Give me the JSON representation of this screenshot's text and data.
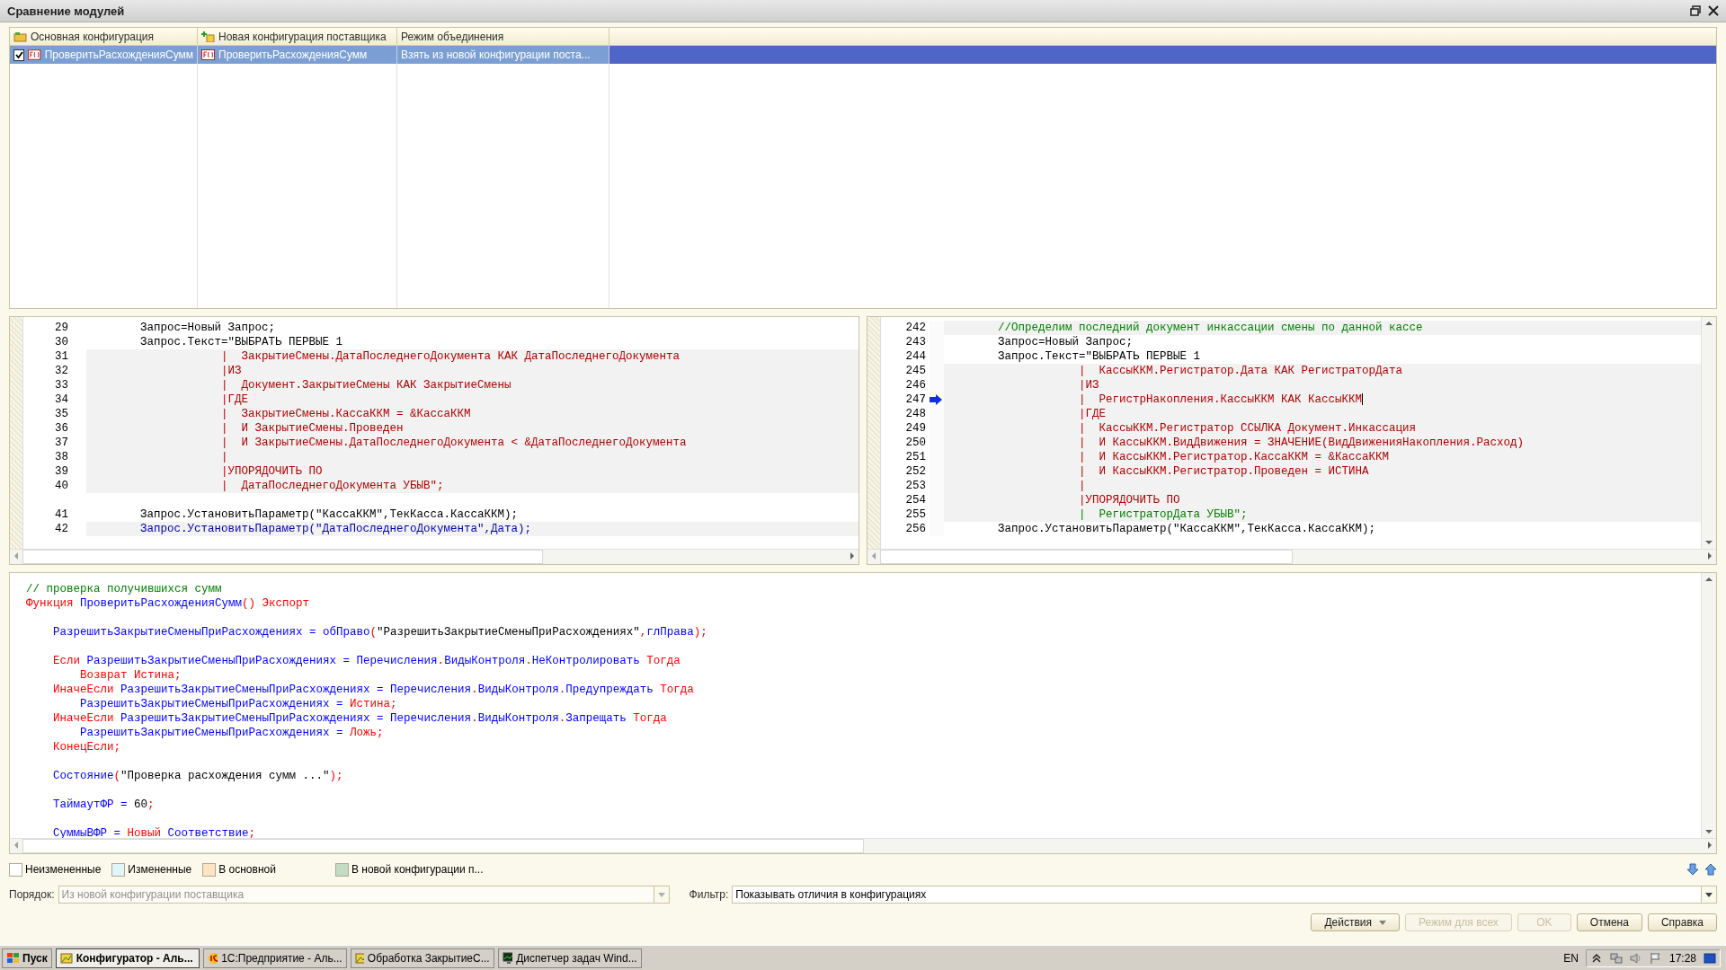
{
  "window": {
    "title": "Сравнение модулей"
  },
  "table": {
    "columns": [
      {
        "label": "Основная конфигурация"
      },
      {
        "label": "Новая конфигурация поставщика"
      },
      {
        "label": "Режим объединения"
      }
    ],
    "rows": [
      {
        "selected": true,
        "checked": true,
        "cells": [
          "ПроверитьРасхожденияСумм",
          "ПроверитьРасхожденияСумм",
          "Взять из новой конфигурации поста..."
        ]
      }
    ]
  },
  "left_pane": {
    "lines": [
      {
        "num": "29",
        "text": "\t\tЗапрос=Новый Запрос;",
        "kind": "plain",
        "highlighted": false
      },
      {
        "num": "30",
        "text": "\t\tЗапрос.Текст=\"ВЫБРАТЬ ПЕРВЫЕ 1",
        "kind": "plain",
        "highlighted": false
      },
      {
        "num": "31",
        "text": "\t\t\t\t\t|  ЗакрытиеСмены.ДатаПоследнегоДокумента КАК ДатаПоследнегоДокумента",
        "kind": "query",
        "highlighted": true
      },
      {
        "num": "32",
        "text": "\t\t\t\t\t|ИЗ",
        "kind": "query",
        "highlighted": true
      },
      {
        "num": "33",
        "text": "\t\t\t\t\t|  Документ.ЗакрытиеСмены КАК ЗакрытиеСмены",
        "kind": "query",
        "highlighted": true
      },
      {
        "num": "34",
        "text": "\t\t\t\t\t|ГДЕ",
        "kind": "query",
        "highlighted": true
      },
      {
        "num": "35",
        "text": "\t\t\t\t\t|  ЗакрытиеСмены.КассаККМ = &КассаККМ",
        "kind": "query",
        "highlighted": true
      },
      {
        "num": "36",
        "text": "\t\t\t\t\t|  И ЗакрытиеСмены.Проведен",
        "kind": "query",
        "highlighted": true
      },
      {
        "num": "37",
        "text": "\t\t\t\t\t|  И ЗакрытиеСмены.ДатаПоследнегоДокумента < &ДатаПоследнегоДокумента",
        "kind": "query",
        "highlighted": true
      },
      {
        "num": "38",
        "text": "\t\t\t\t\t|",
        "kind": "query",
        "highlighted": true
      },
      {
        "num": "39",
        "text": "\t\t\t\t\t|УПОРЯДОЧИТЬ ПО",
        "kind": "query",
        "highlighted": true
      },
      {
        "num": "40",
        "text": "\t\t\t\t\t|  ДатаПоследнегоДокумента УБЫВ\";",
        "kind": "query",
        "highlighted": true
      },
      {
        "kind": "gap"
      },
      {
        "num": "41",
        "text": "\t\tЗапрос.УстановитьПараметр(\"КассаККМ\",ТекКасса.КассаККМ);",
        "kind": "plain",
        "highlighted": false
      },
      {
        "num": "42",
        "text": "\t\tЗапрос.УстановитьПараметр(\"ДатаПоследнегоДокумента\",Дата);",
        "kind": "changed",
        "highlighted": true
      }
    ]
  },
  "right_pane": {
    "lines": [
      {
        "num": "242",
        "text": "\t\t//Определим последний документ инкассации смены по данной кассе",
        "kind": "comment",
        "highlighted": true,
        "current": false
      },
      {
        "num": "243",
        "text": "\t\tЗапрос=Новый Запрос;",
        "kind": "plain",
        "highlighted": false,
        "current": false
      },
      {
        "num": "244",
        "text": "\t\tЗапрос.Текст=\"ВЫБРАТЬ ПЕРВЫЕ 1",
        "kind": "plain",
        "highlighted": false,
        "current": false
      },
      {
        "num": "245",
        "text": "\t\t\t\t\t|  КассыККМ.Регистратор.Дата КАК РегистраторДата",
        "kind": "query",
        "highlighted": true,
        "current": false
      },
      {
        "num": "246",
        "text": "\t\t\t\t\t|ИЗ",
        "kind": "query",
        "highlighted": true,
        "current": false
      },
      {
        "num": "247",
        "text": "\t\t\t\t\t|  РегистрНакопления.КассыККМ КАК КассыККМ",
        "kind": "query",
        "highlighted": true,
        "current": true
      },
      {
        "num": "248",
        "text": "\t\t\t\t\t|ГДЕ",
        "kind": "query",
        "highlighted": true,
        "current": false
      },
      {
        "num": "249",
        "text": "\t\t\t\t\t|  КассыККМ.Регистратор ССЫЛКА Документ.Инкассация",
        "kind": "query",
        "highlighted": true,
        "current": false
      },
      {
        "num": "250",
        "text": "\t\t\t\t\t|  И КассыККМ.ВидДвижения = ЗНАЧЕНИЕ(ВидДвиженияНакопления.Расход)",
        "kind": "query",
        "highlighted": true,
        "current": false
      },
      {
        "num": "251",
        "text": "\t\t\t\t\t|  И КассыККМ.Регистратор.КассаККМ = &КассаККМ",
        "kind": "query",
        "highlighted": true,
        "current": false
      },
      {
        "num": "252",
        "text": "\t\t\t\t\t|  И КассыККМ.Регистратор.Проведен = ИСТИНА",
        "kind": "query",
        "highlighted": true,
        "current": false
      },
      {
        "num": "253",
        "text": "\t\t\t\t\t|",
        "kind": "query",
        "highlighted": true,
        "current": false
      },
      {
        "num": "254",
        "text": "\t\t\t\t\t|УПОРЯДОЧИТЬ ПО",
        "kind": "query",
        "highlighted": true,
        "current": false
      },
      {
        "num": "255",
        "text": "\t\t\t\t\t|  РегистраторДата УБЫВ\";",
        "kind": "comment",
        "highlighted": true,
        "current": false
      },
      {
        "num": "256",
        "text": "\t\tЗапрос.УстановитьПараметр(\"КассаККМ\",ТекКасса.КассаККМ);",
        "kind": "plain",
        "highlighted": false,
        "current": false
      }
    ]
  },
  "module_code": {
    "lines": [
      {
        "segments": [
          {
            "kind": "comment",
            "text": "// проверка получившихся сумм"
          }
        ]
      },
      {
        "segments": [
          {
            "kind": "keyword",
            "text": "Функция "
          },
          {
            "kind": "ident",
            "text": "ПроверитьРасхожденияСумм"
          },
          {
            "kind": "op",
            "text": "() "
          },
          {
            "kind": "keyword",
            "text": "Экспорт"
          }
        ]
      },
      {
        "kind": "blank"
      },
      {
        "segments": [
          {
            "kind": "ident",
            "text": "\tРазрешитьЗакрытиеСменыПриРасхождениях = обПраво"
          },
          {
            "kind": "op",
            "text": "("
          },
          {
            "kind": "string",
            "text": "\"РазрешитьЗакрытиеСменыПриРасхождениях\""
          },
          {
            "kind": "op",
            "text": ","
          },
          {
            "kind": "ident",
            "text": "глПрава"
          },
          {
            "kind": "op",
            "text": ");"
          }
        ]
      },
      {
        "kind": "blank"
      },
      {
        "segments": [
          {
            "kind": "keyword",
            "text": "\tЕсли "
          },
          {
            "kind": "ident",
            "text": "РазрешитьЗакрытиеСменыПриРасхождениях = Перечисления"
          },
          {
            "kind": "op",
            "text": "."
          },
          {
            "kind": "ident",
            "text": "ВидыКонтроля"
          },
          {
            "kind": "op",
            "text": "."
          },
          {
            "kind": "ident",
            "text": "НеКонтролировать "
          },
          {
            "kind": "keyword",
            "text": "Тогда"
          }
        ]
      },
      {
        "segments": [
          {
            "kind": "keyword",
            "text": "\t\tВозврат Истина;"
          }
        ]
      },
      {
        "segments": [
          {
            "kind": "keyword",
            "text": "\tИначеЕсли "
          },
          {
            "kind": "ident",
            "text": "РазрешитьЗакрытиеСменыПриРасхождениях = Перечисления"
          },
          {
            "kind": "op",
            "text": "."
          },
          {
            "kind": "ident",
            "text": "ВидыКонтроля"
          },
          {
            "kind": "op",
            "text": "."
          },
          {
            "kind": "ident",
            "text": "Предупреждать "
          },
          {
            "kind": "keyword",
            "text": "Тогда"
          }
        ]
      },
      {
        "segments": [
          {
            "kind": "ident",
            "text": "\t\tРазрешитьЗакрытиеСменыПриРасхождениях = "
          },
          {
            "kind": "keyword",
            "text": "Истина;"
          }
        ]
      },
      {
        "segments": [
          {
            "kind": "keyword",
            "text": "\tИначеЕсли "
          },
          {
            "kind": "ident",
            "text": "РазрешитьЗакрытиеСменыПриРасхождениях = Перечисления"
          },
          {
            "kind": "op",
            "text": "."
          },
          {
            "kind": "ident",
            "text": "ВидыКонтроля"
          },
          {
            "kind": "op",
            "text": "."
          },
          {
            "kind": "ident",
            "text": "Запрещать "
          },
          {
            "kind": "keyword",
            "text": "Тогда"
          }
        ]
      },
      {
        "segments": [
          {
            "kind": "ident",
            "text": "\t\tРазрешитьЗакрытиеСменыПриРасхождениях = "
          },
          {
            "kind": "keyword",
            "text": "Ложь;"
          }
        ]
      },
      {
        "segments": [
          {
            "kind": "keyword",
            "text": "\tКонецЕсли;"
          }
        ]
      },
      {
        "kind": "blank"
      },
      {
        "segments": [
          {
            "kind": "ident",
            "text": "\tСостояние"
          },
          {
            "kind": "op",
            "text": "("
          },
          {
            "kind": "string",
            "text": "\"Проверка расхождения сумм ...\""
          },
          {
            "kind": "op",
            "text": ");"
          }
        ]
      },
      {
        "kind": "blank"
      },
      {
        "segments": [
          {
            "kind": "ident",
            "text": "\tТаймаутФР = "
          },
          {
            "kind": "string",
            "text": "60"
          },
          {
            "kind": "op",
            "text": ";"
          }
        ]
      },
      {
        "kind": "blank"
      },
      {
        "segments": [
          {
            "kind": "ident",
            "text": "\tСуммыВФР = "
          },
          {
            "kind": "keyword",
            "text": "Новый "
          },
          {
            "kind": "ident",
            "text": "Соответствие"
          },
          {
            "kind": "op",
            "text": ";"
          }
        ]
      }
    ]
  },
  "legend": [
    {
      "label": "Неизмененные",
      "color": "#ffffff"
    },
    {
      "label": "Измененные",
      "color": "#e0f6fa"
    },
    {
      "label": "В основной",
      "color": "#fde4c4"
    },
    {
      "label": "В новой конфигурации п...",
      "color": "#c2dcc4"
    }
  ],
  "order": {
    "label": "Порядок:",
    "value": "Из новой конфигурации поставщика",
    "disabled": true
  },
  "filter": {
    "label": "Фильтр:",
    "value": "Показывать отличия в конфигурациях",
    "disabled": false
  },
  "buttons": [
    {
      "label": "Действия",
      "kind": "menu",
      "disabled": false
    },
    {
      "label": "Режим для всех",
      "kind": "plain",
      "disabled": true
    },
    {
      "label": "OK",
      "kind": "plain",
      "disabled": true
    },
    {
      "label": "Отмена",
      "kind": "plain",
      "disabled": false
    },
    {
      "label": "Справка",
      "kind": "plain",
      "disabled": false
    }
  ],
  "taskbar": {
    "start": "Пуск",
    "tasks": [
      {
        "label": "Конфигуратор - Аль...",
        "selected": true
      },
      {
        "label": "1С:Предприятие - Аль...",
        "selected": false
      },
      {
        "label": "Обработка ЗакрытиеС...",
        "selected": false
      },
      {
        "label": "Диспетчер задач Wind...",
        "selected": false
      }
    ],
    "language": "EN",
    "clock": "17:28"
  }
}
